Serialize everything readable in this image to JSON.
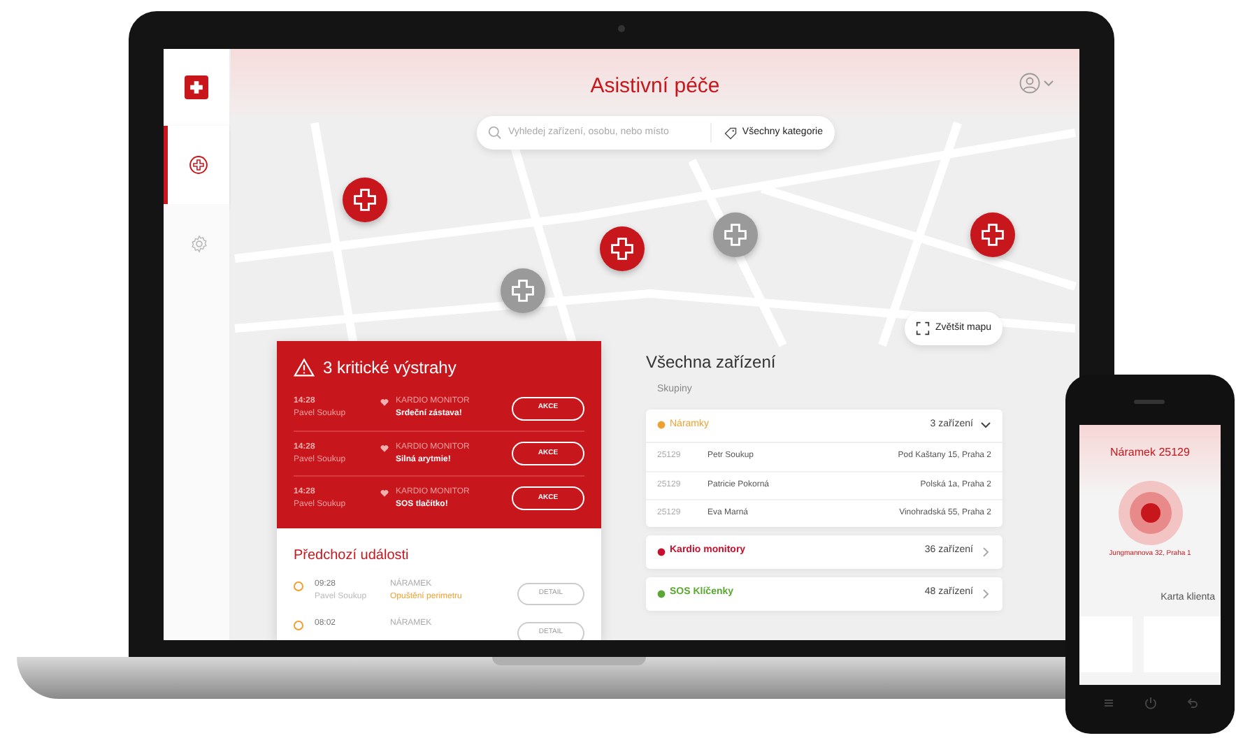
{
  "header": {
    "title": "Asistivní péče"
  },
  "sidebar": {
    "items": [
      {
        "kind": "cross",
        "selected": true
      },
      {
        "kind": "gear",
        "selected": false
      }
    ]
  },
  "search": {
    "placeholder": "Vyhledej zařízení, osobu, nebo místo",
    "category": "Všechny kategorie"
  },
  "map": {
    "pins": [
      {
        "active": true
      },
      {
        "active": false
      },
      {
        "active": true
      },
      {
        "active": false
      },
      {
        "active": true
      }
    ],
    "zoom_button": "Zvětšit mapu"
  },
  "alerts": {
    "title": "3 kritické výstrahy",
    "items": [
      {
        "time": "14:28",
        "person": "Pavel Soukup",
        "device": "KARDIO MONITOR",
        "message": "Srdeční zástava!",
        "action": "AKCE"
      },
      {
        "time": "14:28",
        "person": "Pavel Soukup",
        "device": "KARDIO MONITOR",
        "message": "Silná arytmie!",
        "action": "AKCE"
      },
      {
        "time": "14:28",
        "person": "Pavel Soukup",
        "device": "KARDIO MONITOR",
        "message": "SOS tlačítko!",
        "action": "AKCE"
      }
    ]
  },
  "history": {
    "title": "Předchozí události",
    "items": [
      {
        "time": "09:28",
        "person": "Pavel Soukup",
        "device": "NÁRAMEK",
        "message": "Opuštění perimetru",
        "action": "DETAIL"
      },
      {
        "time": "08:02",
        "device": "NÁRAMEK",
        "action": "DETAIL"
      }
    ]
  },
  "devices": {
    "title": "Všechna zařízení",
    "subtitle": "Skupiny",
    "groups": [
      {
        "name": "Náramky",
        "count": "3 zařízení",
        "expanded": true,
        "color": "#f0a030",
        "rows": [
          {
            "id": "25129",
            "name": "Petr Soukup",
            "address": "Pod Kaštany 15, Praha 2"
          },
          {
            "id": "25129",
            "name": "Patricie Pokorná",
            "address": "Polská 1a, Praha 2"
          },
          {
            "id": "25129",
            "name": "Eva Marná",
            "address": "Vinohradská 55, Praha 2"
          }
        ]
      },
      {
        "name": "Kardio monitory",
        "count": "36 zařízení",
        "expanded": false,
        "color": "#c8102e"
      },
      {
        "name": "SOS Klíčenky",
        "count": "48 zařízení",
        "expanded": false,
        "color": "#5aa832"
      }
    ]
  },
  "phone": {
    "title": "Náramek 25129",
    "address": "Jungmannova 32, Praha 1",
    "card_title": "Karta klienta"
  }
}
